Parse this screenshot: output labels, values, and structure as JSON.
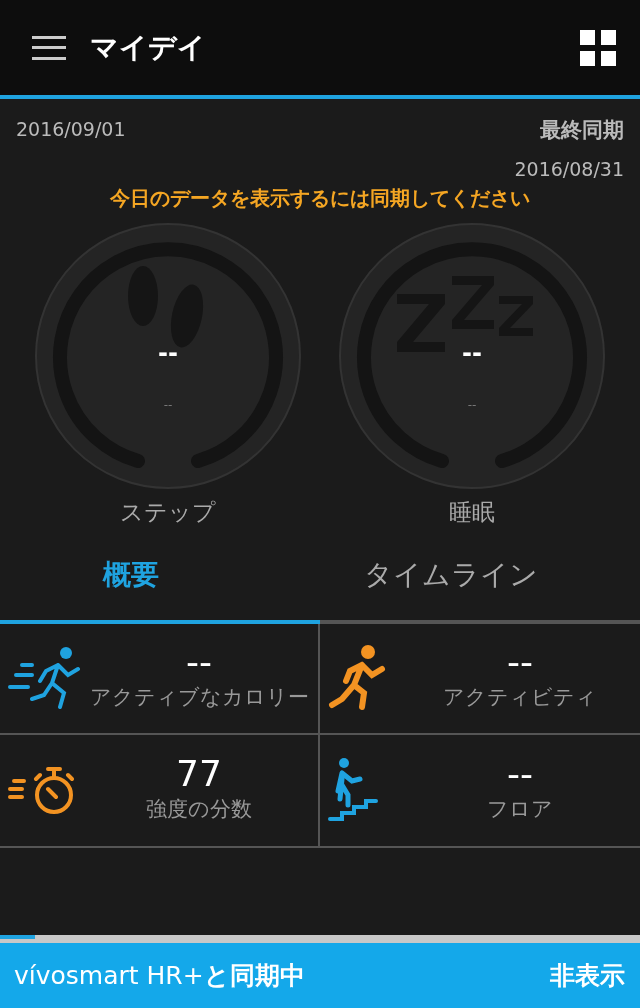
{
  "app_bar": {
    "title": "マイデイ"
  },
  "dates": {
    "current": "2016/09/01",
    "last_sync_label": "最終同期",
    "last_sync": "2016/08/31"
  },
  "notice": "今日のデータを表示するには同期してください",
  "gauges": [
    {
      "kind": "steps",
      "value": "--",
      "sub": "--",
      "label": "ステップ"
    },
    {
      "kind": "sleep",
      "value": "--",
      "sub": "--",
      "label": "睡眠"
    }
  ],
  "tabs": [
    {
      "label": "概要",
      "selected": true
    },
    {
      "label": "タイムライン",
      "selected": false
    }
  ],
  "stats": [
    {
      "kind": "calories",
      "value": "--",
      "label": "アクティブなカロリー"
    },
    {
      "kind": "activity",
      "value": "--",
      "label": "アクティビティ"
    },
    {
      "kind": "intensity",
      "value": "77",
      "label": "強度の分数"
    },
    {
      "kind": "floors",
      "value": "--",
      "label": "フロア"
    }
  ],
  "sync": {
    "level": 0.055,
    "message": "vívosmart HR+**と同期中**",
    "hide": "非表示"
  }
}
